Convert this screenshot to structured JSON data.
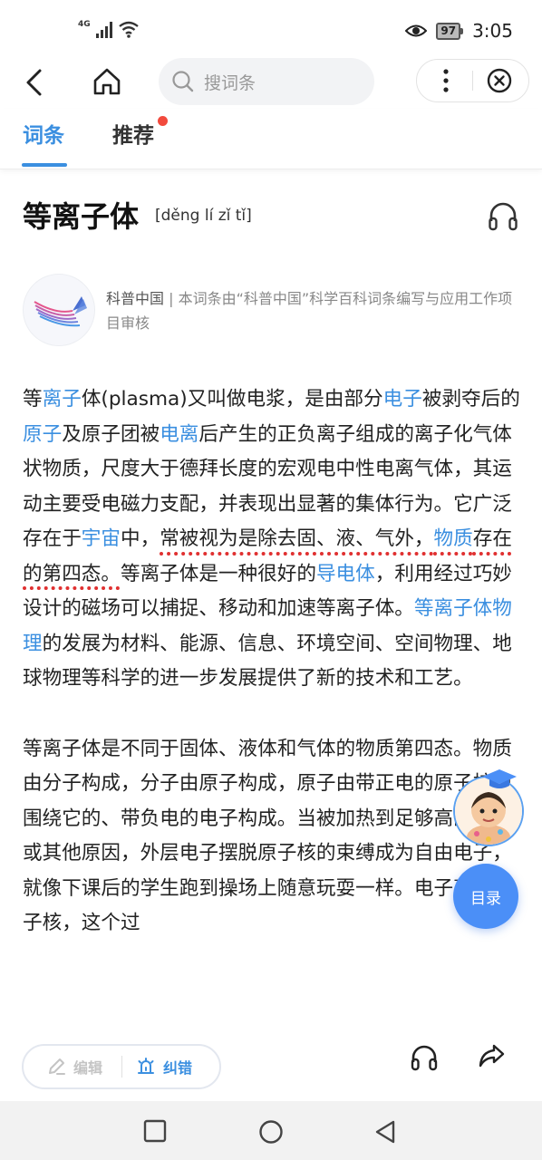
{
  "status_bar": {
    "network": "4G",
    "battery": "97",
    "time": "3:05"
  },
  "nav": {
    "search_placeholder": "搜词条"
  },
  "tabs": [
    {
      "label": "词条"
    },
    {
      "label": "推荐"
    }
  ],
  "entry": {
    "title": "等离子体",
    "pinyin": "[děng lí zǐ tǐ]",
    "source_name": "科普中国",
    "source_sep": " | ",
    "source_desc": "本词条由“科普中国”科学百科词条编写与应用工作项目审核"
  },
  "body": {
    "p1": [
      "等",
      "离子",
      "体(plasma)又叫做电浆，是由部分",
      "电子",
      "被剥夺后的",
      "原子",
      "及原子团被",
      "电离",
      "后产生的正负离子组成的离子化气体状物质，尺度大于德拜长度的宏观电中性电离气体，其运动主要受电磁力支配，并表现出显著的集体行为。它广泛存在于",
      "宇宙",
      "中，",
      "常被视为是除去固、液、气外，",
      "物质",
      "存在的第四态。",
      "等离子体是一种很好的",
      "导电体",
      "，利用经过巧妙设计的磁场可以捕捉、移动和加速等离子体。",
      "等离子体物理",
      "的发展为材料、能源、信息、环境空间、空间物理、地球物理等科学的进一步发展提供了新的技术和工艺。"
    ],
    "p2": "等离子体是不同于固体、液体和气体的物质第四态。物质由分子构成，分子由原子构成，原子由带正电的原子核和围绕它的、带负电的电子构成。当被加热到足够高的温度或其他原因，外层电子摆脱原子核的束缚成为自由电子，就像下课后的学生跑到操场上随意玩耍一样。电子离开原子核，这个过"
  },
  "floating": {
    "toc_label": "目录"
  },
  "bottom_bar": {
    "edit_label": "编辑",
    "correct_label": "纠错"
  },
  "colors": {
    "accent": "#3b8fe0",
    "link": "#3b8fe0",
    "badge": "#f24a3d",
    "toc_bg": "#4b8ff7"
  }
}
